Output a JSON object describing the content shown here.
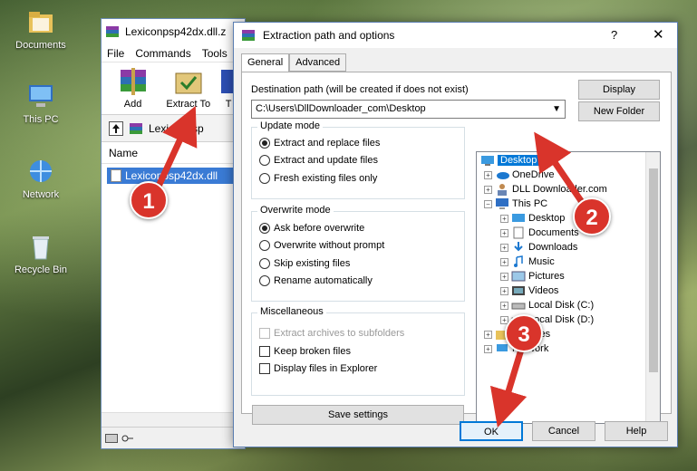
{
  "desktop": {
    "icons": [
      {
        "label": "Documents"
      },
      {
        "label": "This PC"
      },
      {
        "label": "Network"
      },
      {
        "label": "Recycle Bin"
      }
    ]
  },
  "winrar": {
    "title": "Lexiconpsp42dx.dll.z",
    "menu": [
      "File",
      "Commands",
      "Tools"
    ],
    "toolbar": [
      {
        "label": "Add"
      },
      {
        "label": "Extract To"
      },
      {
        "label": "T"
      }
    ],
    "address": "Lexiconpsp",
    "column_name": "Name",
    "file": "Lexiconpsp42dx.dll"
  },
  "dialog": {
    "title": "Extraction path and options",
    "help": "?",
    "close": "✕",
    "tabs": [
      "General",
      "Advanced"
    ],
    "dest_label": "Destination path (will be created if does not exist)",
    "dest_value": "C:\\Users\\DllDownloader_com\\Desktop",
    "display_btn": "Display",
    "new_folder_btn": "New Folder",
    "update_mode": {
      "title": "Update mode",
      "options": [
        "Extract and replace files",
        "Extract and update files",
        "Fresh existing files only"
      ],
      "selected": 0
    },
    "overwrite_mode": {
      "title": "Overwrite mode",
      "options": [
        "Ask before overwrite",
        "Overwrite without prompt",
        "Skip existing files",
        "Rename automatically"
      ],
      "selected": 0
    },
    "misc": {
      "title": "Miscellaneous",
      "options": [
        {
          "label": "Extract archives to subfolders",
          "checked": false,
          "disabled": true
        },
        {
          "label": "Keep broken files",
          "checked": false,
          "disabled": false
        },
        {
          "label": "Display files in Explorer",
          "checked": false,
          "disabled": false
        }
      ]
    },
    "save_settings": "Save settings",
    "tree": [
      {
        "label": "Desktop",
        "icon": "desktop-icon",
        "selected": true
      },
      {
        "label": "OneDrive",
        "icon": "cloud-icon"
      },
      {
        "label": "DLL Downloader.com",
        "icon": "user-icon"
      },
      {
        "label": "This PC",
        "icon": "computer-icon"
      },
      {
        "label": "Desktop",
        "icon": "desktop-icon"
      },
      {
        "label": "Documents",
        "icon": "document-icon"
      },
      {
        "label": "Downloads",
        "icon": "download-icon"
      },
      {
        "label": "Music",
        "icon": "music-icon"
      },
      {
        "label": "Pictures",
        "icon": "picture-icon"
      },
      {
        "label": "Videos",
        "icon": "video-icon"
      },
      {
        "label": "Local Disk (C:)",
        "icon": "drive-icon"
      },
      {
        "label": "Local Disk (D:)",
        "icon": "drive-icon"
      },
      {
        "label": "Libraries",
        "icon": "folder-icon"
      },
      {
        "label": "Network",
        "icon": "network-icon"
      }
    ],
    "ok": "OK",
    "cancel": "Cancel",
    "help_btn": "Help"
  },
  "annotations": [
    "1",
    "2",
    "3"
  ],
  "colors": {
    "accent": "#0078d7",
    "badge": "#d9342b"
  }
}
